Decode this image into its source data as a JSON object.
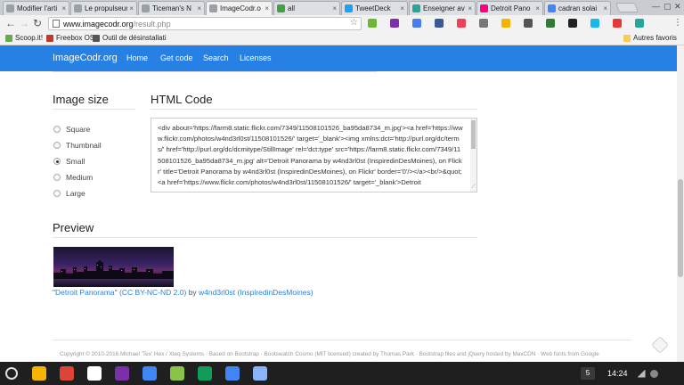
{
  "browser": {
    "tabs": [
      {
        "title": "Modifier l'arti",
        "color": "#9aa0a6"
      },
      {
        "title": "Le propulseur",
        "color": "#9aa0a6"
      },
      {
        "title": "Ticeman's N",
        "color": "#9aa0a6"
      },
      {
        "title": "ImageCodr.o",
        "color": "#9aa0a6"
      },
      {
        "title": "all",
        "color": "#43a047"
      },
      {
        "title": "TweetDeck",
        "color": "#1da1f2"
      },
      {
        "title": "Enseigner av",
        "color": "#26a69a"
      },
      {
        "title": "Detroit Pano",
        "color": "#ff0084"
      },
      {
        "title": "cadran solai",
        "color": "#4285f4"
      }
    ],
    "close_glyph": "×",
    "address": {
      "host": "www.imagecodr.org",
      "path": "/result.php"
    },
    "bookmarks": [
      {
        "label": "Scoop.it!",
        "color": "#6aa84f"
      },
      {
        "label": "Freebox OS",
        "color": "#c0392b"
      },
      {
        "label": "Outil de désinstallati",
        "color": "#555555"
      }
    ],
    "bookmarks_other": "Autres favoris",
    "extensions": [
      {
        "icon": "evernote-icon",
        "color": "#6fb536"
      },
      {
        "icon": "onenote-icon",
        "color": "#7b2fa8"
      },
      {
        "icon": "bookmark-icon",
        "color": "#4a7cf0"
      },
      {
        "icon": "klout-icon",
        "color": "#3b5998"
      },
      {
        "icon": "pocket-icon",
        "color": "#ef4056"
      },
      {
        "icon": "camera-icon",
        "color": "#777777"
      },
      {
        "icon": "chrome-icon",
        "color": "#f4b400"
      },
      {
        "icon": "keep-icon",
        "color": "#555555"
      },
      {
        "icon": "shield-icon",
        "color": "#2e7d32"
      },
      {
        "icon": "circle-icon",
        "color": "#222222"
      },
      {
        "icon": "vimeo-icon",
        "color": "#1ab7ea"
      },
      {
        "icon": "tag-icon",
        "color": "#e53935"
      },
      {
        "icon": "bracket-icon",
        "color": "#26a69a"
      }
    ]
  },
  "site": {
    "brand": "ImageCodr.org",
    "nav": [
      "Home",
      "Get code",
      "Search",
      "Licenses"
    ],
    "image_size": {
      "heading": "Image size",
      "options": [
        "Square",
        "Thumbnail",
        "Small",
        "Medium",
        "Large"
      ],
      "selected": "Small"
    },
    "html_code": {
      "heading": "HTML Code",
      "code": "<div about='https://farm8.static.flickr.com/7349/11508101526_ba95da8734_m.jpg'><a href='https://www.flickr.com/photos/w4nd3rl0st/11508101526/' target='_blank'><img xmlns:dct='http://purl.org/dc/terms/' href='http://purl.org/dc/dcmitype/StillImage' rel='dct:type' src='https://farm8.static.flickr.com/7349/11508101526_ba95da8734_m.jpg' alt='Detroit Panorama by w4nd3rl0st (InspiredinDesMoines), on Flickr' title='Detroit Panorama by w4nd3rl0st (InspiredinDesMoines), on Flickr' border='0'/></a><br/>&quot;<a href='https://www.flickr.com/photos/w4nd3rl0st/11508101526/' target='_blank'>Detroit"
    },
    "preview": {
      "heading": "Preview",
      "title_link": "Detroit Panorama",
      "open_quote": "\"",
      "close_quote": "\"",
      "license_open": " (",
      "license": "CC BY-NC-ND 2.0",
      "license_close": ")",
      "by": " by ",
      "author": "w4nd3rl0st (InspiredinDesMoines)"
    },
    "footer": "Copyright © 2010-2016 Michael 'Tex' Hex / Xteq Systems · Based on Bootstrap · Bootswatch Cosmo (MIT licensed) created by Thomas Park · Bootstrap files and jQuery hosted by MaxCDN · Web fonts from Google"
  },
  "shelf": {
    "apps": [
      {
        "icon": "drive-icon",
        "color": "#f4b400"
      },
      {
        "icon": "chrome-icon",
        "color": "#db4437"
      },
      {
        "icon": "gmail-icon",
        "color": "#ffffff"
      },
      {
        "icon": "onenote-icon",
        "color": "#7b2fa8"
      },
      {
        "icon": "docs-icon",
        "color": "#4285f4"
      },
      {
        "icon": "photos-icon",
        "color": "#8bc34a"
      },
      {
        "icon": "sheets-icon",
        "color": "#0f9d58"
      },
      {
        "icon": "files-icon",
        "color": "#4285f4"
      },
      {
        "icon": "calendar-icon",
        "color": "#8ab4f8"
      }
    ],
    "notification_count": "5",
    "time": "14:24"
  }
}
